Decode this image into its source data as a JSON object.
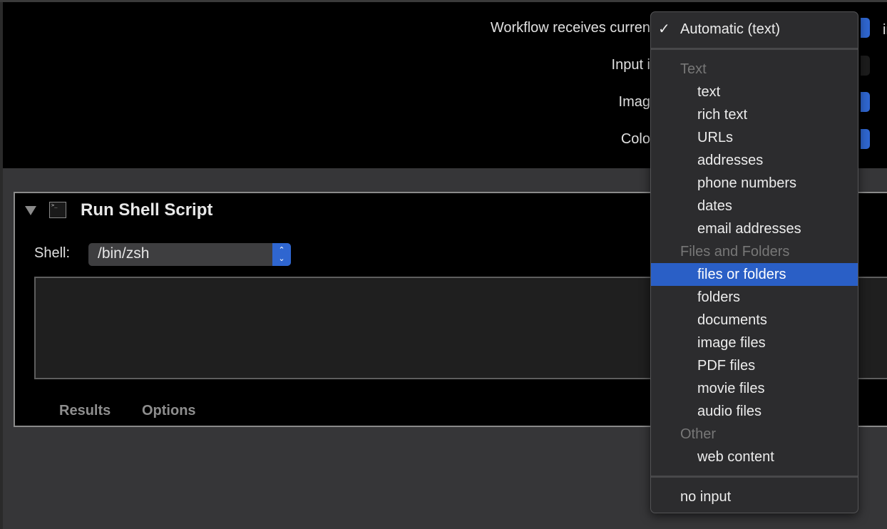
{
  "header": {
    "labels": [
      "Workflow receives curren",
      "Input i",
      "Imag",
      "Colo"
    ],
    "trailing_text": "in"
  },
  "action": {
    "title": "Run Shell Script",
    "icon": "terminal-icon",
    "terminal_glyph": ">_",
    "shell_label": "Shell:",
    "shell_value": "/bin/zsh",
    "tabs": [
      "Results",
      "Options"
    ]
  },
  "menu": {
    "checked": "Automatic (text)",
    "check_mark": "✓",
    "groups": [
      {
        "header": "Text",
        "items": [
          "text",
          "rich text",
          "URLs",
          "addresses",
          "phone numbers",
          "dates",
          "email addresses"
        ]
      },
      {
        "header": "Files and Folders",
        "items": [
          "files or folders",
          "folders",
          "documents",
          "image files",
          "PDF files",
          "movie files",
          "audio files"
        ]
      },
      {
        "header": "Other",
        "items": [
          "web content"
        ]
      }
    ],
    "highlighted": "files or folders",
    "last": "no input"
  },
  "colors": {
    "accent": "#2f66d0",
    "highlight": "#2a5fc6",
    "menu_bg": "#2c2c2e"
  }
}
